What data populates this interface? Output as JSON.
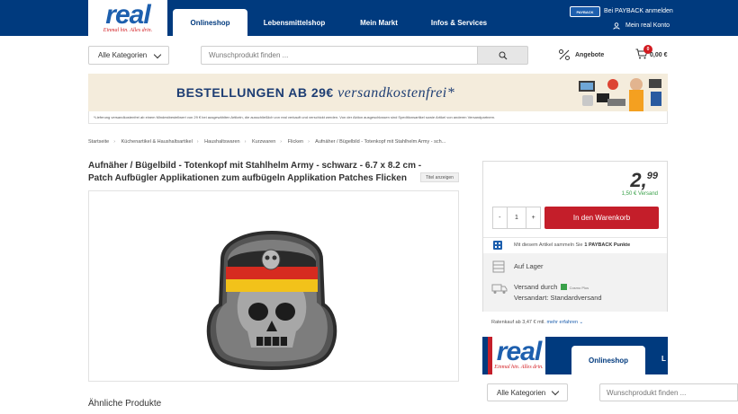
{
  "header": {
    "logo_text": "real",
    "logo_tagline": "Einmal hin. Alles drin.",
    "tabs": [
      {
        "label": "Onlineshop",
        "active": true
      },
      {
        "label": "Lebensmittelshop",
        "active": false
      },
      {
        "label": "Mein Markt",
        "active": false
      },
      {
        "label": "Infos & Services",
        "active": false
      }
    ],
    "payback_logo": "PAYBACK",
    "payback_login": "Bei PAYBACK anmelden",
    "account_link": "Mein real Konto",
    "brand_color": "#003a7e"
  },
  "search": {
    "category_value": "Alle Kategorien",
    "placeholder": "Wunschprodukt finden ...",
    "offers_label": "Angebote",
    "cart_count": "0",
    "cart_total": "0,00 €"
  },
  "banner": {
    "text_main": "BESTELLUNGEN AB 29€",
    "text_script": "versandkostenfrei*",
    "footnote": "*Lieferung versandkostenfrei ab einem Mindestbestellwert von 29 € bei ausgewählten Artikeln, die ausschließlich von real verkauft und verschickt werden. Von der Aktion ausgeschlossen sind Speditionsartikel sowie Artikel von anderen Versandpartnern."
  },
  "breadcrumb": [
    "Startseite",
    "Küchenartikel & Haushaltsartikel",
    "Haushaltswaren",
    "Kurzwaren",
    "Flicken",
    "Aufnäher / Bügelbild - Totenkopf mit Stahlhelm Army - sch..."
  ],
  "product": {
    "title": "Aufnäher / Bügelbild - Totenkopf mit Stahlhelm Army - schwarz - 6.7 x 8.2 cm - Patch Aufbügler Applikationen zum aufbügeln Applikation Patches Flicken",
    "show_title_button": "Titel anzeigen",
    "image_icon": "skull-helmet-patch-image"
  },
  "buybox": {
    "price_main": "2,",
    "price_cents": "99",
    "shipping_cost": "1,50 € Versand",
    "qty_minus": "-",
    "qty_value": "1",
    "qty_plus": "+",
    "add_to_cart": "In den Warenkorb",
    "payback_prefix": "Mit diesem Artikel sammeln Sie",
    "payback_points": "1 PAYBACK Punkte",
    "stock": "Auf Lager",
    "shipped_by_label": "Versand durch",
    "seller_logo": "Cosmo Plus",
    "shipping_type": "Versandart: Standardversand",
    "installment_prefix": "Ratenkauf ab 3,47 € mtl.",
    "installment_link": "mehr erfahren",
    "cart_button_color": "#c41e2a",
    "shipping_color": "#3aa14a"
  },
  "ad": {
    "logo_text": "real",
    "logo_tagline": "Einmal hin. Alles drin.",
    "tab_label": "Onlineshop",
    "tab2_label": "L",
    "select_value": "Alle Kategorien",
    "search_placeholder": "Wunschprodukt finden ..."
  },
  "similar_heading": "Ähnliche Produkte"
}
